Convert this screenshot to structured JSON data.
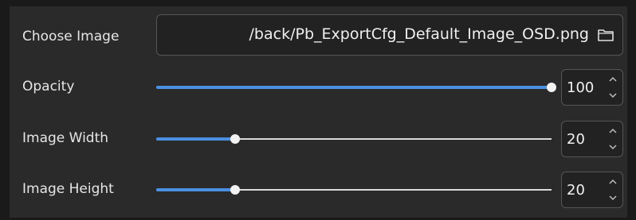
{
  "image_picker": {
    "label": "Choose Image",
    "path": "/back/Pb_ExportCfg_Default_Image_OSD.png",
    "browse_icon": "folder-icon"
  },
  "sliders": [
    {
      "id": "opacity",
      "label": "Opacity",
      "value": 100,
      "min": 0,
      "max": 100,
      "value_text": "100"
    },
    {
      "id": "image-width",
      "label": "Image Width",
      "value": 20,
      "min": 0,
      "max": 100,
      "value_text": "20"
    },
    {
      "id": "image-height",
      "label": "Image Height",
      "value": 20,
      "min": 0,
      "max": 100,
      "value_text": "20"
    }
  ],
  "colors": {
    "background": "#1a1a1a",
    "panel": "#2a2a2a",
    "accent": "#4a90e2",
    "track": "#d9d9d9"
  }
}
